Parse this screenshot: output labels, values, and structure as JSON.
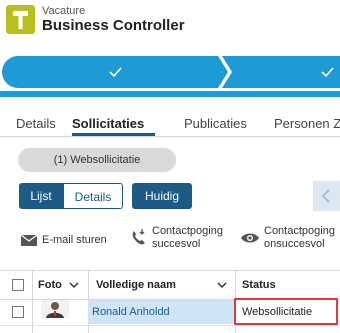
{
  "header": {
    "label": "Vacature",
    "title": "Business Controller",
    "logo_color": "#b7c01f"
  },
  "stepper": {
    "color": "#1e9ad6",
    "steps": [
      "check-icon",
      "check-icon"
    ]
  },
  "tabs": [
    {
      "label": "Details",
      "active": false
    },
    {
      "label": "Sollicitaties",
      "active": true
    },
    {
      "label": "Publicaties",
      "active": false
    },
    {
      "label": "Personen Zo",
      "active": false
    }
  ],
  "filter": {
    "label": "(1) Websollicitatie"
  },
  "view": {
    "lijst": "Lijst",
    "details": "Details",
    "huidig": "Huidig"
  },
  "actions": {
    "email": "E-mail sturen",
    "contact_success_1": "Contactpoging",
    "contact_success_2": "succesvol",
    "contact_fail_1": "Contactpoging",
    "contact_fail_2": "onsuccesvol"
  },
  "table": {
    "columns": {
      "foto": "Foto",
      "name": "Volledige naam",
      "status": "Status"
    },
    "rows": [
      {
        "name": "Ronald Anholdd",
        "status": "Websollicitatie"
      }
    ]
  },
  "colors": {
    "primary": "#1b5b86",
    "accent": "#1e9ad6",
    "highlight": "#e0393e"
  }
}
